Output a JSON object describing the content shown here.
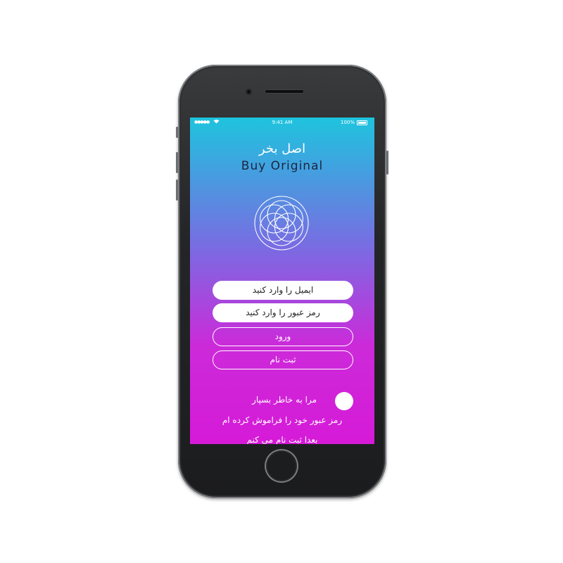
{
  "status_bar": {
    "signal": "●●●●●",
    "time": "9:41 AM",
    "battery": "100%"
  },
  "app": {
    "title_fa": "اصل بخر",
    "title_en": "Buy Original",
    "logo_icon": "rosette-logo-icon"
  },
  "form": {
    "email_placeholder": "ایمیل را وارد کنید",
    "password_placeholder": "رمز عبور را وارد کنید",
    "login_label": "ورود",
    "register_label": "ثبت نام",
    "remember_label": "مرا به خاطر بسپار",
    "forgot_label": "رمز عبور خود را فراموش کرده ام",
    "later_label": "بعدا ثبت نام می کنم"
  },
  "colors": {
    "gradient_top": "#1ec4de",
    "gradient_mid": "#7a6be2",
    "gradient_bottom": "#d61ad8",
    "title_en": "#1f2540"
  }
}
